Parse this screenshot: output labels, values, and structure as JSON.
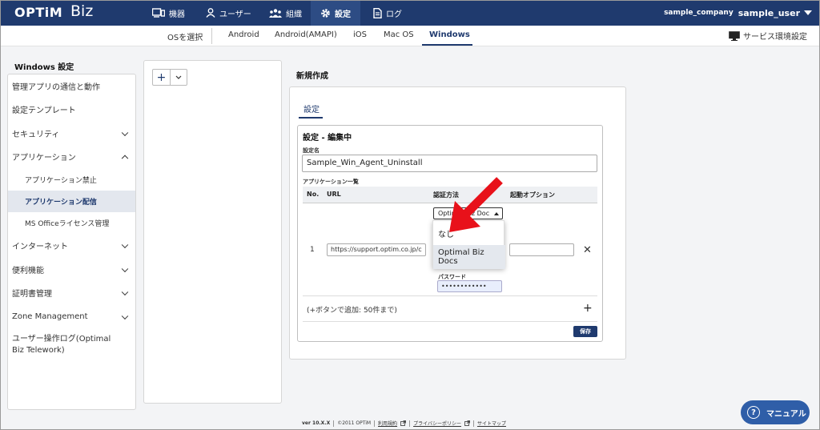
{
  "header": {
    "logo_main": "OPTiM",
    "logo_sub": "Biz",
    "nav": [
      {
        "label": "機器",
        "icon": "device-icon"
      },
      {
        "label": "ユーザー",
        "icon": "user-icon"
      },
      {
        "label": "組織",
        "icon": "org-icon"
      },
      {
        "label": "設定",
        "icon": "gear-icon"
      },
      {
        "label": "ログ",
        "icon": "log-icon"
      }
    ],
    "active_nav": "設定",
    "company": "sample_company",
    "user": "sample_user"
  },
  "os_bar": {
    "select_label": "OSを選択",
    "tabs": [
      "Android",
      "Android(AMAPI)",
      "iOS",
      "Mac OS",
      "Windows"
    ],
    "active_tab": "Windows",
    "service_settings": "サービス環境設定"
  },
  "sidebar": {
    "title": "Windows 設定",
    "items": [
      {
        "label": "管理アプリの通信と動作"
      },
      {
        "label": "設定テンプレート"
      },
      {
        "label": "セキュリティ"
      },
      {
        "label": "アプリケーション"
      },
      {
        "label": "アプリケーション禁止"
      },
      {
        "label": "アプリケーション配信"
      },
      {
        "label": "MS Officeライセンス管理"
      },
      {
        "label": "インターネット"
      },
      {
        "label": "便利機能"
      },
      {
        "label": "証明書管理"
      },
      {
        "label": "Zone Management"
      },
      {
        "label": "ユーザー操作ログ(Optimal Biz Telework)"
      }
    ],
    "active_item": "アプリケーション配信"
  },
  "middle": {
    "add_label": "+"
  },
  "main": {
    "title": "新規作成",
    "tab": "設定",
    "edit_title": "設定 - 編集中",
    "name_label": "設定名",
    "name_value": "Sample_Win_Agent_Uninstall",
    "applist_label": "アプリケーション一覧",
    "columns": [
      "No.",
      "URL",
      "認証方法",
      "起動オプション"
    ],
    "row": {
      "no": "1",
      "url": "https://support.optim.co.jp/c",
      "auth_selected": "Optimal Biz Doc",
      "password_label": "パスワード",
      "password_value": "••••••••••••",
      "close": "✕"
    },
    "dropdown_options": [
      "なし",
      "Optimal Biz Docs"
    ],
    "dropdown_highlighted": "Optimal Biz Docs",
    "add_hint": "(+ボタンで追加: 50件まで)",
    "add_plus": "+",
    "save": "保存"
  },
  "footer": {
    "version": "ver 10.X.X",
    "copyright": "©2011 OPTiM",
    "links": [
      "利用規約",
      "プライバシーポリシー",
      "サイトマップ"
    ]
  },
  "manual_button": "マニュアル",
  "colors": {
    "navy": "#1f3a6e",
    "accent": "#2f5ea8",
    "arrow": "#e8111a"
  }
}
